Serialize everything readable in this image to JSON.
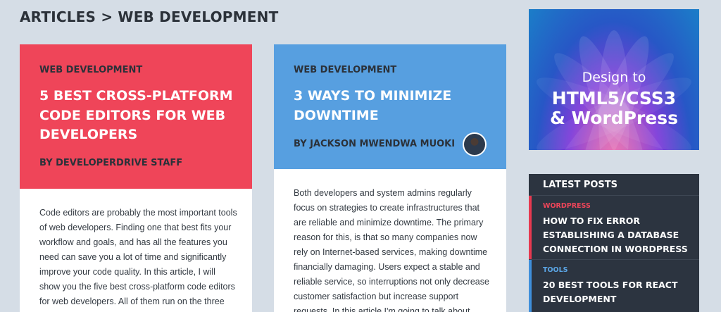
{
  "breadcrumb": "ARTICLES > WEB DEVELOPMENT",
  "colors": {
    "red_card": "#ef4559",
    "blue_card": "#579fe0",
    "sidebar_dark": "#2c3440"
  },
  "articles": [
    {
      "category": "WEB DEVELOPMENT",
      "title": "5 BEST CROSS-PLATFORM CODE EDITORS FOR WEB DEVELOPERS",
      "author": "BY DEVELOPERDRIVE STAFF",
      "excerpt": "Code editors are probably the most important tools of web developers. Finding one that best fits your workflow and goals, and has all the features you need can save you a lot of time and significantly improve your code quality. In this article, I will show you the five best cross-platform code editors for web developers. All of them run on the three major"
    },
    {
      "category": "WEB DEVELOPMENT",
      "title": "3 WAYS TO MINIMIZE DOWNTIME",
      "author": "BY JACKSON MWENDWA MUOKI",
      "excerpt": "Both developers and system admins regularly focus on strategies to create infrastructures that are reliable and minimize downtime. The primary reason for this, is that so many companies now rely on Internet-based services, making downtime financially damaging. Users expect a stable and reliable service, so interruptions not only decrease customer satisfaction but increase support requests. In this article I'm going to talk about"
    }
  ],
  "promo": {
    "line1": "Design to",
    "line2": "HTML5/CSS3",
    "line3": "& WordPress"
  },
  "latest": {
    "heading": "LATEST POSTS",
    "posts": [
      {
        "category": "WORDPRESS",
        "title": "HOW TO FIX ERROR ESTABLISHING A DATABASE CONNECTION IN WORDPRESS"
      },
      {
        "category": "TOOLS",
        "title": "20 BEST TOOLS FOR REACT DEVELOPMENT"
      }
    ]
  }
}
